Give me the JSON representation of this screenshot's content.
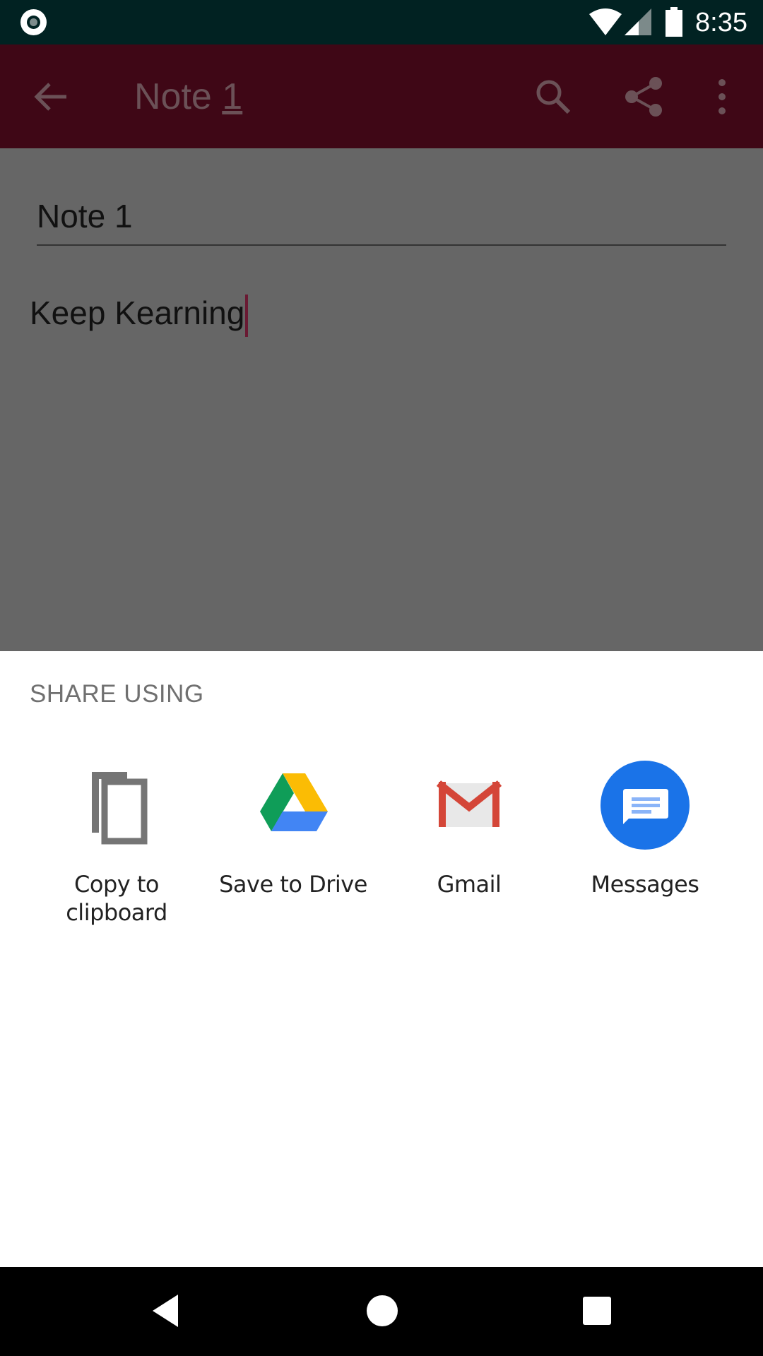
{
  "status_bar": {
    "time": "8:35",
    "icons": [
      "screen-record-icon",
      "wifi-icon",
      "signal-icon",
      "battery-icon"
    ]
  },
  "app_bar": {
    "title_prefix": "Note ",
    "title_suffix": "1",
    "icons": [
      "back-arrow-icon",
      "search-icon",
      "share-icon",
      "more-vert-icon"
    ],
    "background_color": "#3f0716"
  },
  "note": {
    "title": "Note 1",
    "body": "Keep Kearning"
  },
  "share_sheet": {
    "heading": "SHARE USING",
    "targets": [
      {
        "label": "Copy to clipboard",
        "icon": "copy-icon"
      },
      {
        "label": "Save to Drive",
        "icon": "google-drive-icon"
      },
      {
        "label": "Gmail",
        "icon": "gmail-icon"
      },
      {
        "label": "Messages",
        "icon": "messages-icon"
      }
    ]
  },
  "nav_bar": {
    "icons": [
      "nav-back-icon",
      "nav-home-icon",
      "nav-recents-icon"
    ]
  },
  "colors": {
    "scrim": "#666666",
    "status_bar": "#012222",
    "accent_cursor": "#6a1a33",
    "messages_blue": "#1a73e8"
  }
}
